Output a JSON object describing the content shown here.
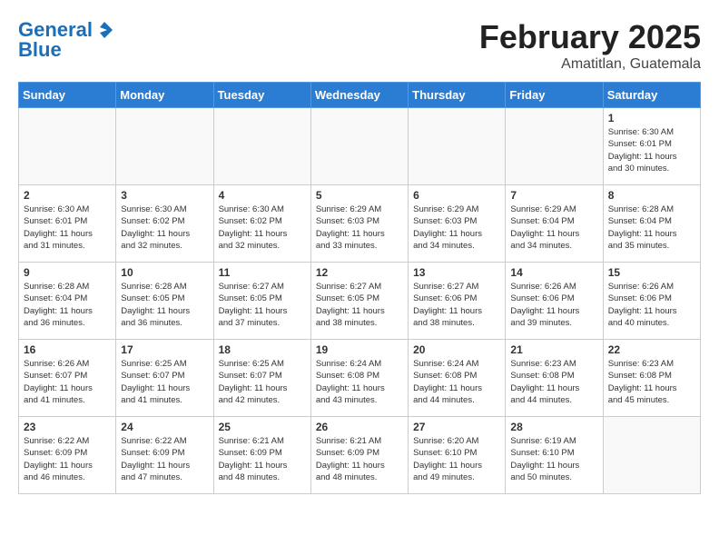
{
  "header": {
    "logo_line1": "General",
    "logo_line2": "Blue",
    "title": "February 2025",
    "subtitle": "Amatitlan, Guatemala"
  },
  "days_of_week": [
    "Sunday",
    "Monday",
    "Tuesday",
    "Wednesday",
    "Thursday",
    "Friday",
    "Saturday"
  ],
  "weeks": [
    [
      {
        "day": "",
        "info": ""
      },
      {
        "day": "",
        "info": ""
      },
      {
        "day": "",
        "info": ""
      },
      {
        "day": "",
        "info": ""
      },
      {
        "day": "",
        "info": ""
      },
      {
        "day": "",
        "info": ""
      },
      {
        "day": "1",
        "info": "Sunrise: 6:30 AM\nSunset: 6:01 PM\nDaylight: 11 hours\nand 30 minutes."
      }
    ],
    [
      {
        "day": "2",
        "info": "Sunrise: 6:30 AM\nSunset: 6:01 PM\nDaylight: 11 hours\nand 31 minutes."
      },
      {
        "day": "3",
        "info": "Sunrise: 6:30 AM\nSunset: 6:02 PM\nDaylight: 11 hours\nand 32 minutes."
      },
      {
        "day": "4",
        "info": "Sunrise: 6:30 AM\nSunset: 6:02 PM\nDaylight: 11 hours\nand 32 minutes."
      },
      {
        "day": "5",
        "info": "Sunrise: 6:29 AM\nSunset: 6:03 PM\nDaylight: 11 hours\nand 33 minutes."
      },
      {
        "day": "6",
        "info": "Sunrise: 6:29 AM\nSunset: 6:03 PM\nDaylight: 11 hours\nand 34 minutes."
      },
      {
        "day": "7",
        "info": "Sunrise: 6:29 AM\nSunset: 6:04 PM\nDaylight: 11 hours\nand 34 minutes."
      },
      {
        "day": "8",
        "info": "Sunrise: 6:28 AM\nSunset: 6:04 PM\nDaylight: 11 hours\nand 35 minutes."
      }
    ],
    [
      {
        "day": "9",
        "info": "Sunrise: 6:28 AM\nSunset: 6:04 PM\nDaylight: 11 hours\nand 36 minutes."
      },
      {
        "day": "10",
        "info": "Sunrise: 6:28 AM\nSunset: 6:05 PM\nDaylight: 11 hours\nand 36 minutes."
      },
      {
        "day": "11",
        "info": "Sunrise: 6:27 AM\nSunset: 6:05 PM\nDaylight: 11 hours\nand 37 minutes."
      },
      {
        "day": "12",
        "info": "Sunrise: 6:27 AM\nSunset: 6:05 PM\nDaylight: 11 hours\nand 38 minutes."
      },
      {
        "day": "13",
        "info": "Sunrise: 6:27 AM\nSunset: 6:06 PM\nDaylight: 11 hours\nand 38 minutes."
      },
      {
        "day": "14",
        "info": "Sunrise: 6:26 AM\nSunset: 6:06 PM\nDaylight: 11 hours\nand 39 minutes."
      },
      {
        "day": "15",
        "info": "Sunrise: 6:26 AM\nSunset: 6:06 PM\nDaylight: 11 hours\nand 40 minutes."
      }
    ],
    [
      {
        "day": "16",
        "info": "Sunrise: 6:26 AM\nSunset: 6:07 PM\nDaylight: 11 hours\nand 41 minutes."
      },
      {
        "day": "17",
        "info": "Sunrise: 6:25 AM\nSunset: 6:07 PM\nDaylight: 11 hours\nand 41 minutes."
      },
      {
        "day": "18",
        "info": "Sunrise: 6:25 AM\nSunset: 6:07 PM\nDaylight: 11 hours\nand 42 minutes."
      },
      {
        "day": "19",
        "info": "Sunrise: 6:24 AM\nSunset: 6:08 PM\nDaylight: 11 hours\nand 43 minutes."
      },
      {
        "day": "20",
        "info": "Sunrise: 6:24 AM\nSunset: 6:08 PM\nDaylight: 11 hours\nand 44 minutes."
      },
      {
        "day": "21",
        "info": "Sunrise: 6:23 AM\nSunset: 6:08 PM\nDaylight: 11 hours\nand 44 minutes."
      },
      {
        "day": "22",
        "info": "Sunrise: 6:23 AM\nSunset: 6:08 PM\nDaylight: 11 hours\nand 45 minutes."
      }
    ],
    [
      {
        "day": "23",
        "info": "Sunrise: 6:22 AM\nSunset: 6:09 PM\nDaylight: 11 hours\nand 46 minutes."
      },
      {
        "day": "24",
        "info": "Sunrise: 6:22 AM\nSunset: 6:09 PM\nDaylight: 11 hours\nand 47 minutes."
      },
      {
        "day": "25",
        "info": "Sunrise: 6:21 AM\nSunset: 6:09 PM\nDaylight: 11 hours\nand 48 minutes."
      },
      {
        "day": "26",
        "info": "Sunrise: 6:21 AM\nSunset: 6:09 PM\nDaylight: 11 hours\nand 48 minutes."
      },
      {
        "day": "27",
        "info": "Sunrise: 6:20 AM\nSunset: 6:10 PM\nDaylight: 11 hours\nand 49 minutes."
      },
      {
        "day": "28",
        "info": "Sunrise: 6:19 AM\nSunset: 6:10 PM\nDaylight: 11 hours\nand 50 minutes."
      },
      {
        "day": "",
        "info": ""
      }
    ]
  ]
}
